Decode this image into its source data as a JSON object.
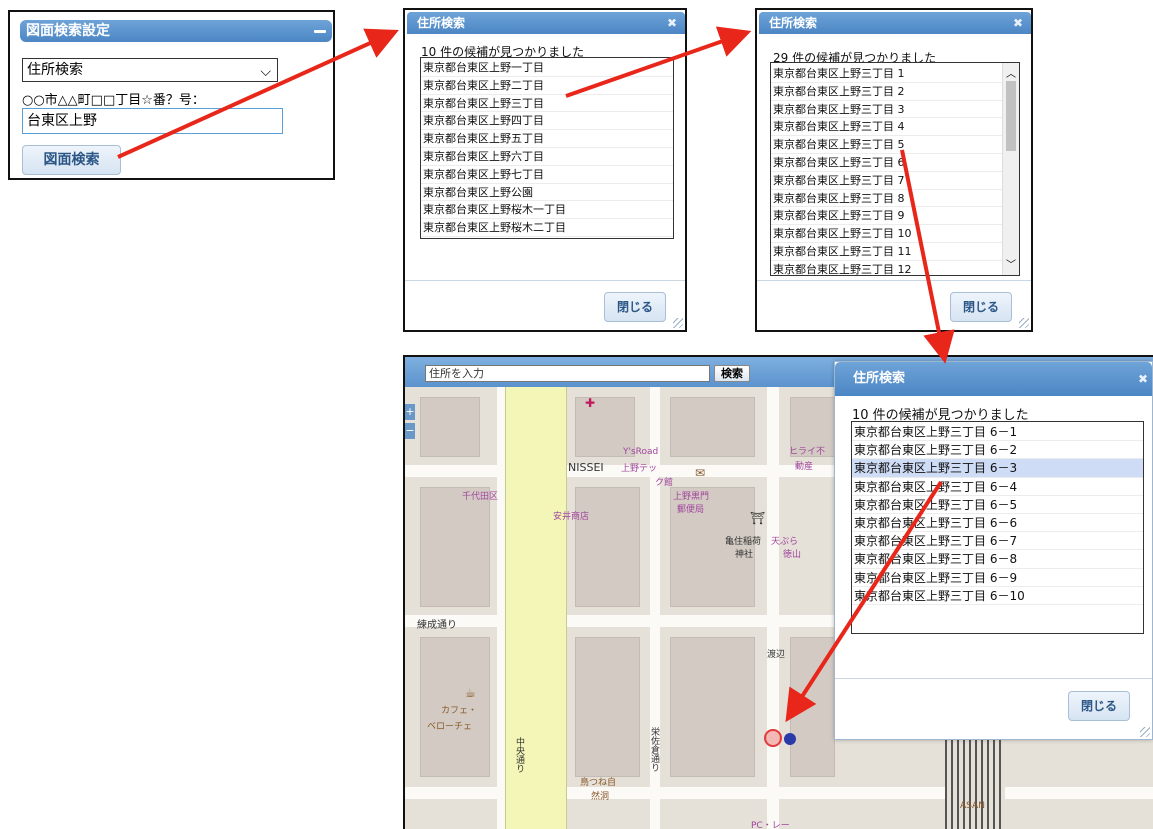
{
  "panel_settings": {
    "title": "図面検索設定",
    "select_value": "住所検索",
    "hint": "○○市△△町□□丁目☆番？号：",
    "input_value": "台東区上野",
    "search_button": "図面検索"
  },
  "dialog1": {
    "title": "住所検索",
    "message": "10 件の候補が見つかりました",
    "items": [
      "東京都台東区上野一丁目",
      "東京都台東区上野二丁目",
      "東京都台東区上野三丁目",
      "東京都台東区上野四丁目",
      "東京都台東区上野五丁目",
      "東京都台東区上野六丁目",
      "東京都台東区上野七丁目",
      "東京都台東区上野公園",
      "東京都台東区上野桜木一丁目",
      "東京都台東区上野桜木二丁目"
    ],
    "close_button": "閉じる"
  },
  "dialog2": {
    "title": "住所検索",
    "message": "29 件の候補が見つかりました",
    "items": [
      "東京都台東区上野三丁目 1",
      "東京都台東区上野三丁目 2",
      "東京都台東区上野三丁目 3",
      "東京都台東区上野三丁目 4",
      "東京都台東区上野三丁目 5",
      "東京都台東区上野三丁目 6",
      "東京都台東区上野三丁目 7",
      "東京都台東区上野三丁目 8",
      "東京都台東区上野三丁目 9",
      "東京都台東区上野三丁目 10",
      "東京都台東区上野三丁目 11",
      "東京都台東区上野三丁目 12"
    ],
    "close_button": "閉じる"
  },
  "map": {
    "address_placeholder": "住所を入力",
    "search_button": "検索",
    "zoom_in": "+",
    "zoom_out": "−",
    "labels": [
      "千代田区",
      "NISSEI",
      "Y'sRoad",
      "上野テッ",
      "ク館",
      "安井商店",
      "上野黒門",
      "郵便局",
      "ヒライ不",
      "動産",
      "亀住稲荷",
      "神社",
      "天ぷら",
      "徳山",
      "練成通り",
      "渡辺",
      "カフェ・",
      "ベローチェ",
      "中央通り",
      "栄佐倉通り",
      "鳥つね自",
      "然洞",
      "ASAN",
      "PC・レー"
    ]
  },
  "dialog3": {
    "title": "住所検索",
    "message": "10 件の候補が見つかりました",
    "items": [
      "東京都台東区上野三丁目 6－1",
      "東京都台東区上野三丁目 6－2",
      "東京都台東区上野三丁目 6－3",
      "東京都台東区上野三丁目 6－4",
      "東京都台東区上野三丁目 6－5",
      "東京都台東区上野三丁目 6－6",
      "東京都台東区上野三丁目 6－7",
      "東京都台東区上野三丁目 6－8",
      "東京都台東区上野三丁目 6－9",
      "東京都台東区上野三丁目 6－10"
    ],
    "selected_index": 2,
    "close_button": "閉じる"
  },
  "colors": {
    "title_bar": "#5b93cd",
    "selected_row": "#cfdcf6",
    "arrow": "#e8261a",
    "marker_red": "#e23b3b",
    "marker_blue": "#2a3aa8"
  }
}
